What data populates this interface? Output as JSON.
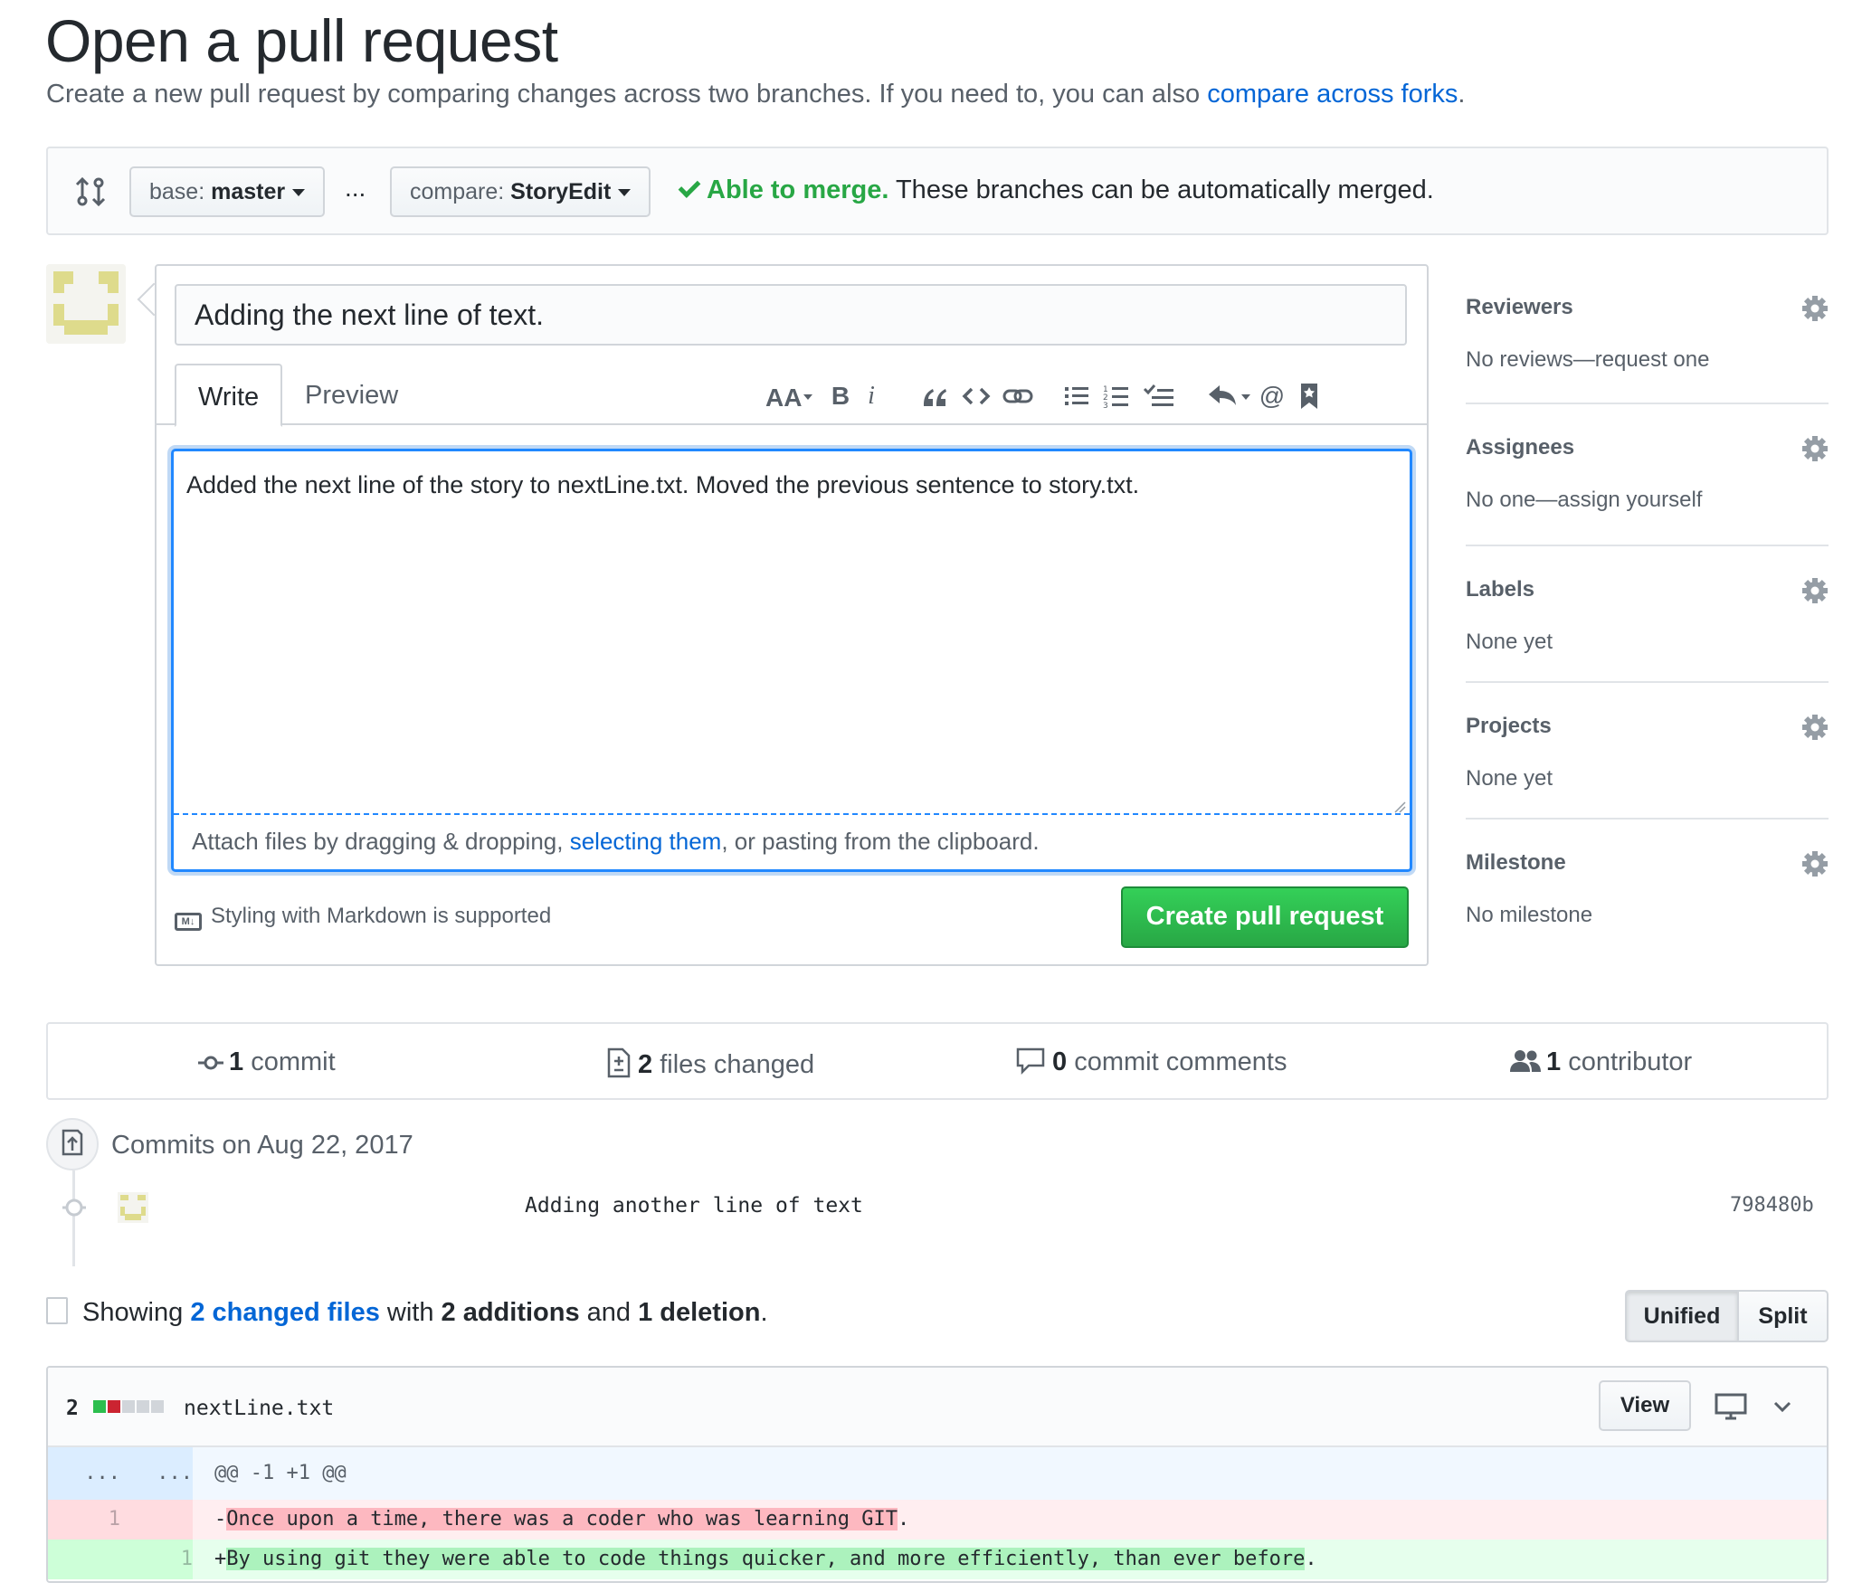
{
  "header": {
    "title": "Open a pull request",
    "subtitle_prefix": "Create a new pull request by comparing changes across two branches. If you need to, you can also ",
    "subtitle_link": "compare across forks",
    "subtitle_suffix": "."
  },
  "range": {
    "base_label": "base:",
    "base_value": "master",
    "separator": "...",
    "compare_label": "compare:",
    "compare_value": "StoryEdit",
    "merge_status": "Able to merge.",
    "merge_detail": " These branches can be automatically merged."
  },
  "form": {
    "title_value": "Adding the next line of text.",
    "tabs": [
      "Write",
      "Preview"
    ],
    "body_value": "Added the next line of the story to nextLine.txt. Moved the previous sentence to story.txt.",
    "attach_prefix": "Attach files by dragging & dropping, ",
    "attach_link": "selecting them",
    "attach_suffix": ", or pasting from the clipboard.",
    "markdown_note": "Styling with Markdown is supported",
    "markdown_icon_text": "M↓",
    "submit_label": "Create pull request",
    "toolbar_icons": [
      "header-icon",
      "bold-icon",
      "italic-icon",
      "quote-icon",
      "code-icon",
      "link-icon",
      "bullet-list-icon",
      "numbered-list-icon",
      "task-list-icon",
      "reply-icon",
      "mention-icon",
      "bookmark-icon"
    ]
  },
  "sidebar": {
    "sections": [
      {
        "heading": "Reviewers",
        "value": "No reviews—request one"
      },
      {
        "heading": "Assignees",
        "value": "No one—assign yourself"
      },
      {
        "heading": "Labels",
        "value": "None yet"
      },
      {
        "heading": "Projects",
        "value": "None yet"
      },
      {
        "heading": "Milestone",
        "value": "No milestone"
      }
    ]
  },
  "stats": {
    "commits_count": "1",
    "commits_label": " commit",
    "files_count": "2",
    "files_label": " files changed",
    "comments_count": "0",
    "comments_label": " commit comments",
    "contributors_count": "1",
    "contributors_label": " contributor"
  },
  "commits": {
    "date_label": "Commits on Aug 22, 2017",
    "items": [
      {
        "message": "Adding another line of text",
        "sha": "798480b"
      }
    ]
  },
  "files_toc": {
    "prefix": "Showing ",
    "link": "2 changed files",
    "middle": " with ",
    "additions": "2 additions",
    "and": " and ",
    "deletions": "1 deletion",
    "end": ".",
    "view_modes": [
      "Unified",
      "Split"
    ],
    "selected_mode": "Unified"
  },
  "diff_file": {
    "change_count": "2",
    "filename": "nextLine.txt",
    "view_label": "View",
    "hunk_left": "...",
    "hunk_right": "...",
    "hunk_header": "@@ -1 +1 @@",
    "del_line_num": "1",
    "del_sign": "-",
    "del_text": "Once upon a time, there was a coder who was learning GIT",
    "del_trailing": ".",
    "add_line_num": "1",
    "add_sign": "+",
    "add_text": "By using git they were able to code things quicker, and more efficiently, than ever before",
    "add_trailing": "."
  },
  "colors": {
    "accent_blue": "#0366d6",
    "success_green": "#28a745",
    "addition_bg": "#e6ffed",
    "deletion_bg": "#ffeef0"
  }
}
